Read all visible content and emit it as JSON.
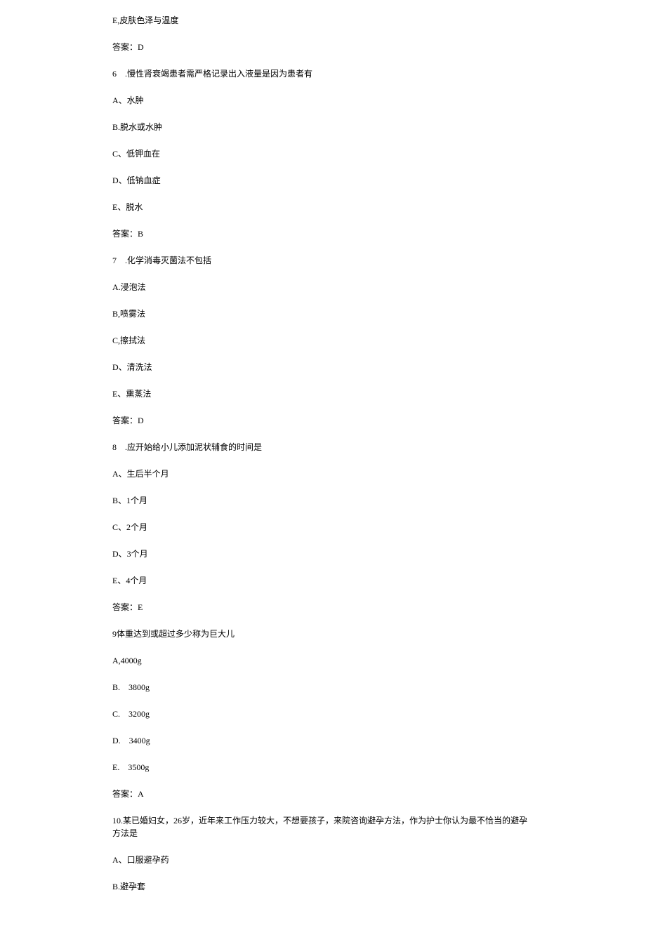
{
  "lines": [
    "E,皮肤色泽与温度",
    "答案：D",
    "6　.慢性肾衰竭患者需严格记录出入液量是因为患者有",
    "A、水肿",
    "B.脱水或水肿",
    "C、低钾血在",
    "D、低钠血症",
    "E、脱水",
    "答案：B",
    "7　.化学消毒灭菌法不包括",
    "A.浸泡法",
    "B,喷雾法",
    "C,擦拭法",
    "D、清洗法",
    "E、熏蒸法",
    "答案：D",
    "8　.应开始给小儿添加泥状辅食的时间是",
    "A、生后半个月",
    "B、1个月",
    "C、2个月",
    "D、3个月",
    "E、4个月",
    "答案：E",
    "9体重达到或超过多少称为巨大儿",
    "A,4000g",
    "B.　3800g",
    "C.　3200g",
    "D.　3400g",
    "E.　3500g",
    "答案：A",
    "10.某已婚妇女，26岁，近年来工作压力较大，不想要孩子，来院咨询避孕方法，作为护士你认为最不恰当的避孕方法是",
    "A、口服避孕药",
    "B.避孕套"
  ]
}
